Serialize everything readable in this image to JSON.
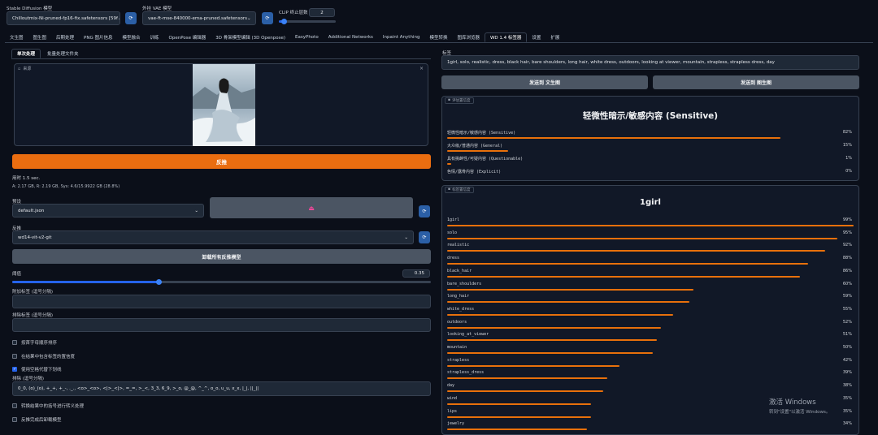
{
  "header": {
    "sd_model_label": "Stable Diffusion 模型",
    "sd_model_value": "Chilloutmix-Ni-pruned-fp16-fix.safetensors [59f",
    "vae_label": "外挂 VAE 模型",
    "vae_value": "vae-ft-mse-840000-ema-pruned.safetensors",
    "clip_label": "CLIP 终止层数",
    "clip_value": "2",
    "clip_fraction": 0.09
  },
  "tabs": [
    "文生图",
    "图生图",
    "后期处理",
    "PNG 图片信息",
    "模型融合",
    "训练",
    "OpenPose 编辑器",
    "3D 骨架模型编辑 (3D Openpose)",
    "EasyPhoto",
    "Additional Networks",
    "Inpaint Anything",
    "模型转换",
    "图库浏览器",
    "WD 1.4 标签器",
    "设置",
    "扩展"
  ],
  "active_tab": 13,
  "left": {
    "subtabs": [
      "单次处理",
      "批量处理文件夹"
    ],
    "source_label": "来源",
    "interrogate_btn": "反推",
    "time_text": "用时 1.5 sec.",
    "mem_text": "A: 2.17 GB, R: 2.19 GB, Sys: 4.6/15.9922 GB (28.8%)",
    "preset_label": "预设",
    "preset_value": "default.json",
    "interrogator_label": "反推",
    "interrogator_value": "wd14-vit-v2-git",
    "unload_btn": "卸载所有反推模型",
    "threshold_label": "阈值",
    "threshold_value": "0.35",
    "threshold_fraction": 0.35,
    "additional_tags_label": "附加标签 (逗号分隔)",
    "exclude_tags_label": "排除标签 (逗号分隔)",
    "chk_sort": "按首字母顺序排序",
    "chk_include_conf": "在结果中包含标签的置信度",
    "chk_underscore": "使用空格代替下划线",
    "escape_label": "排除 (逗号分隔)",
    "escape_value": "0_0, (o)_(o), +_+, +_-, ._., <o>_<o>, <|>_<|>, =_=, >_<, 3_3, 6_9, >_o, @_@, ^_^, o_o, u_u, x_x, |_|, ||_||",
    "chk_escape": "转换结果中的括号进行转义处理",
    "chk_unload": "反推完成后卸载模型"
  },
  "right": {
    "tags_label": "标签",
    "tags_text": "1girl, solo, realistic, dress, black hair, bare shoulders, long hair, white dress, outdoors, looking at viewer, mountain, strapless, strapless dress, day",
    "send_txt2img": "发送到 文生图",
    "send_img2img": "发送到 图生图",
    "rating_panel_label": "评估置信度",
    "rating_title": "轻微性暗示/敏感内容 (Sensitive)",
    "ratings": [
      {
        "name": "轻微性暗示/敏感内容 (Sensitive)",
        "pct": "82%",
        "v": 0.82
      },
      {
        "name": "大众级/普通内容 (General)",
        "pct": "15%",
        "v": 0.15
      },
      {
        "name": "具有挑衅性/可疑内容 (Questionable)",
        "pct": "1%",
        "v": 0.01
      },
      {
        "name": "色情/露骨内容 (Explicit)",
        "pct": "0%",
        "v": 0.0
      }
    ],
    "tags_panel_label": "标签置信度",
    "tags_title": "1girl",
    "tag_confidences": [
      {
        "name": "1girl",
        "pct": "99%",
        "v": 0.99
      },
      {
        "name": "solo",
        "pct": "95%",
        "v": 0.95
      },
      {
        "name": "realistic",
        "pct": "92%",
        "v": 0.92
      },
      {
        "name": "dress",
        "pct": "88%",
        "v": 0.88
      },
      {
        "name": "black_hair",
        "pct": "86%",
        "v": 0.86
      },
      {
        "name": "bare_shoulders",
        "pct": "60%",
        "v": 0.6
      },
      {
        "name": "long_hair",
        "pct": "59%",
        "v": 0.59
      },
      {
        "name": "white_dress",
        "pct": "55%",
        "v": 0.55
      },
      {
        "name": "outdoors",
        "pct": "52%",
        "v": 0.52
      },
      {
        "name": "looking_at_viewer",
        "pct": "51%",
        "v": 0.51
      },
      {
        "name": "mountain",
        "pct": "50%",
        "v": 0.5
      },
      {
        "name": "strapless",
        "pct": "42%",
        "v": 0.42
      },
      {
        "name": "strapless_dress",
        "pct": "39%",
        "v": 0.39
      },
      {
        "name": "day",
        "pct": "38%",
        "v": 0.38
      },
      {
        "name": "wind",
        "pct": "35%",
        "v": 0.35
      },
      {
        "name": "lips",
        "pct": "35%",
        "v": 0.35
      },
      {
        "name": "jewelry",
        "pct": "34%",
        "v": 0.34
      }
    ]
  },
  "watermark": {
    "line1": "激活 Windows",
    "line2": "转到\"设置\"以激活 Windows。"
  },
  "colors": {
    "accent": "#e8700b",
    "blue": "#2563eb",
    "bg": "#0b0f19",
    "panel": "#111827"
  }
}
